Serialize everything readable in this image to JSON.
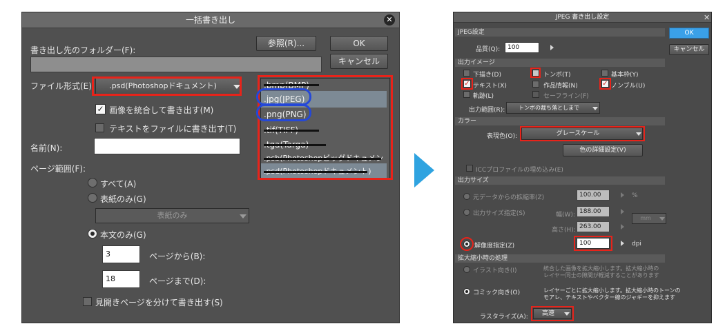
{
  "colors": {
    "highlight_red": "#e8231a",
    "highlight_blue": "#2448d8",
    "accent_blue": "#2fa3e0",
    "ok_blue": "#3aa0e8"
  },
  "left": {
    "title": "一括書き出し",
    "dest_folder_label": "書き出し先のフォルダー(F):",
    "browse_btn": "参照(R)...",
    "ok_btn": "OK",
    "cancel_btn": "キャンセル",
    "file_format_label": "ファイル形式(E):",
    "file_format_value": ".psd(Photoshopドキュメント)",
    "merge_images": "画像を統合して書き出す(M)",
    "text_to_file": "テキストをファイルに書き出す(T)",
    "name_label": "名前(N):",
    "page_range_label": "ページ範囲(F):",
    "all_label": "すべて(A)",
    "cover_only_label": "表紙のみ(G)",
    "cover_only_dd": "表紙のみ",
    "body_only_label": "本文のみ(G)",
    "from_value": "3",
    "from_label": "ページから(B):",
    "to_value": "18",
    "to_label": "ページまで(D):",
    "spread_label": "見開きページを分けて書き出す(S)",
    "format_options": [
      ".bmp(BMP)",
      ".jpg(JPEG)",
      ".png(PNG)",
      ".tif(TIFF)",
      ".tga(Targa)",
      ".psb(Photoshopビッグドキュメント)",
      ".psd(Photoshopドキュメント)"
    ]
  },
  "right": {
    "title": "JPEG 書き出し設定",
    "ok_btn": "OK",
    "cancel_btn": "キャンセル",
    "jpeg_settings": "JPEG設定",
    "quality_label": "品質(Q):",
    "quality_value": "100",
    "output_image": "出力イメージ",
    "chk_draft": "下描き(D)",
    "chk_tombo": "トンボ(T)",
    "chk_basic_frame": "基本枠(Y)",
    "chk_text": "テキスト(X)",
    "chk_work_info": "作品情報(N)",
    "chk_nombre": "ノンブル(U)",
    "chk_trajectory": "軌跡(L)",
    "chk_safe_line": "セーフライン(F)",
    "output_range_label": "出力範囲(R):",
    "output_range_value": "トンボの裁ち落としまで",
    "color": "カラー",
    "color_mode_label": "表現色(O):",
    "color_mode_value": "グレースケール",
    "color_detail_btn": "色の詳細設定(V)",
    "icc_embed": "ICCプロファイルの埋め込み(E)",
    "output_size": "出力サイズ",
    "scale_from_original": "元データからの拡縮率(Z)",
    "scale_value": "100.00",
    "scale_unit": "%",
    "output_size_spec": "出力サイズ指定(S)",
    "width_label": "幅(W):",
    "width_value": "188.00",
    "height_label": "高さ(H):",
    "height_value": "263.00",
    "size_unit": "mm",
    "resolution_spec": "解像度指定(Z)",
    "resolution_value": "100",
    "resolution_unit": "dpi",
    "scaling_process": "拡大縮小時の処理",
    "illust_pref": "イラスト向き(I)",
    "illust_desc": "統合した画像を拡大縮小します。拡大縮小時の\nレイヤー同士の隙間が軽減することがあります",
    "comic_pref": "コミック向き(O)",
    "comic_desc": "レイヤーごとに拡大縮小します。拡大縮小時のトーンの\nモアレ、テキストやベクター線のジャギーを抑えます",
    "rasterize_label": "ラスタライズ(A):",
    "rasterize_value": "高速"
  }
}
